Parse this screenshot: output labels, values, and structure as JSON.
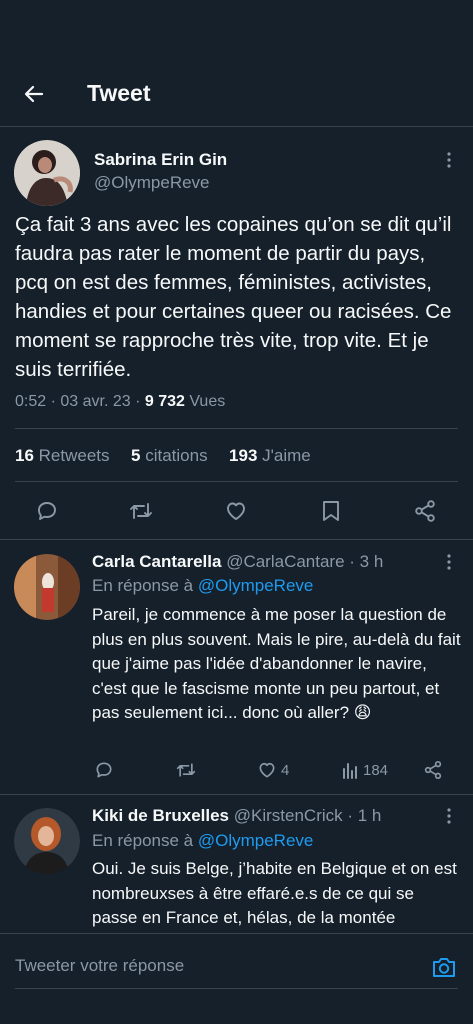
{
  "header": {
    "title": "Tweet",
    "back_icon": "arrow-left-icon"
  },
  "tweet": {
    "author_name": "Sabrina Erin Gin",
    "author_handle": "@OlympeReve",
    "text": "Ça fait 3 ans avec les copaines qu’on se dit qu’il faudra pas rater le moment de partir du pays, pcq on est des femmes, féministes, activistes, handies et pour certaines queer ou racisées. Ce moment se rapproche très vite, trop vite. Et je suis terrifiée.",
    "timestamp": "0:52 · 03 avr. 23 · ",
    "views_count": "9 732",
    "views_label": " Vues",
    "stats": {
      "retweets_count": "16",
      "retweets_label": "Retweets",
      "quotes_count": "5",
      "quotes_label": "citations",
      "likes_count": "193",
      "likes_label": "J'aime"
    }
  },
  "replies": [
    {
      "author_name": "Carla Cantarella",
      "author_handle": "@CarlaCantare",
      "time": " · 3 h",
      "reply_prefix": "En réponse à ",
      "reply_to": "@OlympeReve",
      "text": "Pareil, je commence à me poser la question de plus en plus souvent. Mais le pire, au-delà du fait que j'aime pas l'idée d'abandonner le navire, c'est que le fascisme monte un peu partout, et pas seulement ici... donc où aller? 😩",
      "likes": "4",
      "views": "184"
    },
    {
      "author_name": "Kiki de Bruxelles",
      "author_handle": "@KirstenCrick",
      "time": " · 1 h",
      "reply_prefix": "En réponse à ",
      "reply_to": "@OlympeReve",
      "text": "Oui. Je suis Belge, j’habite en Belgique et on est nombreuxses à être effaré.e.s de ce qui se passe en France et, hélas, de la montée"
    }
  ],
  "composer": {
    "placeholder": "Tweeter votre réponse",
    "camera_icon": "camera-icon"
  },
  "colors": {
    "background": "#15202b",
    "accent": "#1d9bf0",
    "muted": "#8b98a5",
    "divider": "#38444d"
  }
}
